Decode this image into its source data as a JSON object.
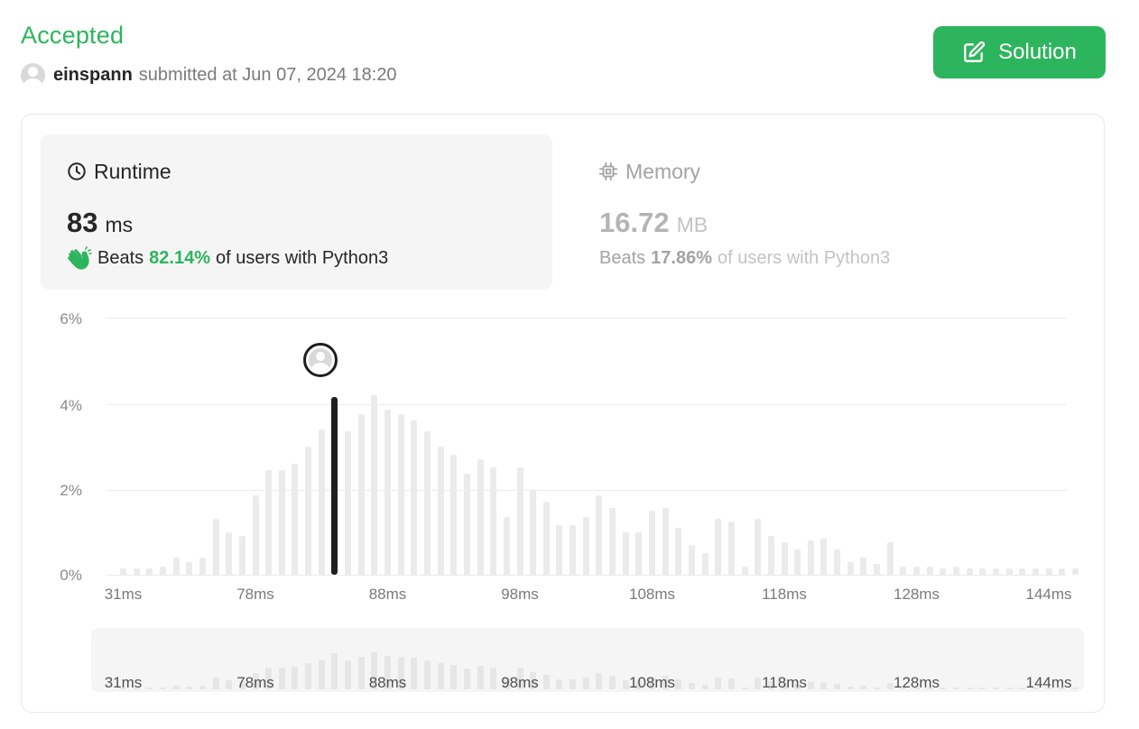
{
  "header": {
    "status": "Accepted",
    "username": "einspann",
    "submitted_text": "submitted at Jun 07, 2024 18:20"
  },
  "solution_button": {
    "label": "Solution",
    "icon": "edit-icon"
  },
  "runtime": {
    "title": "Runtime",
    "icon": "clock-icon",
    "value": "83",
    "unit": "ms",
    "beats_prefix": "Beats",
    "beats_pct": "82.14%",
    "beats_suffix": "of users with Python3",
    "beats_icon": "clapping-hands-icon"
  },
  "memory": {
    "title": "Memory",
    "icon": "chip-icon",
    "value": "16.72",
    "unit": "MB",
    "beats_prefix": "Beats",
    "beats_pct": "17.86%",
    "beats_suffix": "of users with Python3"
  },
  "colors": {
    "accent": "#2db55d",
    "selected_bar": "#1f1f1f",
    "bar": "#ebebeb"
  },
  "chart_data": {
    "type": "bar",
    "ylim": [
      0,
      6
    ],
    "y_ticks": [
      "6%",
      "4%",
      "2%",
      "0%"
    ],
    "x_tick_labels": [
      "31ms",
      "78ms",
      "88ms",
      "98ms",
      "108ms",
      "118ms",
      "128ms",
      "144ms"
    ],
    "x_tick_bar_index": [
      0,
      10,
      20,
      30,
      40,
      50,
      60,
      70
    ],
    "selected_bar_index": 16,
    "values": [
      0.15,
      0.15,
      0.15,
      0.2,
      0.4,
      0.3,
      0.4,
      1.3,
      1.0,
      0.9,
      1.85,
      2.45,
      2.45,
      2.6,
      3.0,
      3.4,
      4.15,
      3.35,
      3.75,
      4.2,
      3.85,
      3.75,
      3.6,
      3.35,
      3.0,
      2.8,
      2.35,
      2.7,
      2.5,
      1.35,
      2.5,
      1.95,
      1.7,
      1.15,
      1.15,
      1.35,
      1.85,
      1.55,
      1.0,
      1.0,
      1.5,
      1.55,
      1.1,
      0.7,
      0.5,
      1.3,
      1.25,
      0.2,
      1.3,
      0.9,
      0.75,
      0.6,
      0.8,
      0.85,
      0.6,
      0.3,
      0.4,
      0.25,
      0.75,
      0.2,
      0.2,
      0.2,
      0.15,
      0.2,
      0.15,
      0.15,
      0.15,
      0.15,
      0.15,
      0.15,
      0.15,
      0.15,
      0.15
    ]
  }
}
